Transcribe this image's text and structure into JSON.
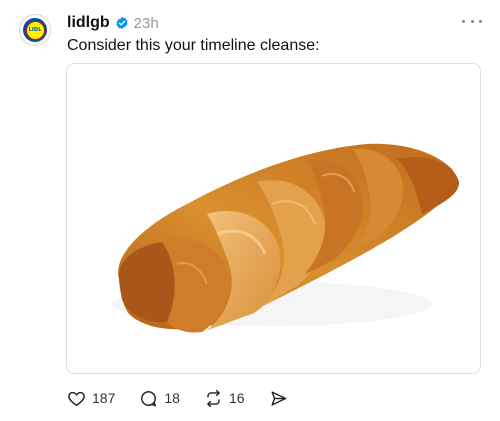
{
  "post": {
    "author": {
      "username": "lidlgb",
      "logo_text": "LIDL",
      "verified_icon": "verified-badge-icon",
      "avatar_icon": "lidl-logo"
    },
    "timestamp": "23h",
    "caption": "Consider this your timeline cleanse:",
    "media": {
      "subject": "croissant-image"
    },
    "actions": {
      "like": {
        "icon": "heart-icon",
        "count": "187"
      },
      "reply": {
        "icon": "comment-icon",
        "count": "18"
      },
      "repost": {
        "icon": "repost-icon",
        "count": "16"
      },
      "share": {
        "icon": "send-icon"
      }
    }
  },
  "colors": {
    "verified": "#0095f6",
    "logo_blue": "#0050aa",
    "logo_yellow": "#fff500",
    "logo_red": "#e60a14",
    "timestamp": "#999999"
  }
}
